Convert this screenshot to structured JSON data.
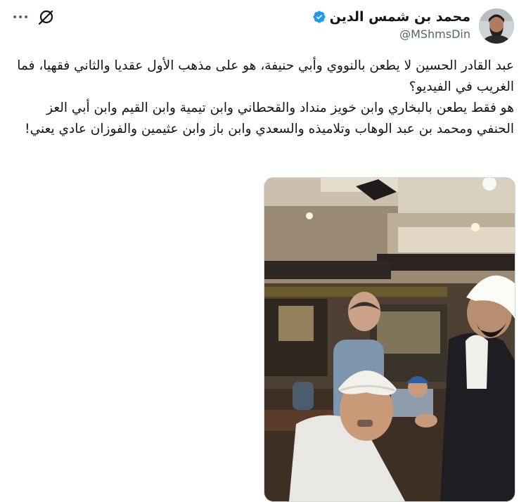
{
  "author": {
    "display_name": "محمد بن شمس الدين",
    "handle": "@MShmsDin",
    "verified": true
  },
  "icons": {
    "verified": "verified-badge-icon",
    "grok": "grok-icon",
    "more": "more-options-icon"
  },
  "tweet": {
    "paragraph_1": "عبد القادر الحسين لا يطعن بالنووي وأبي حنيفة، هو على مذهب الأول عقديا والثاني فقهيا، فما الغريب في الفيديو؟",
    "paragraph_2": "هو فقط يطعن بالبخاري وابن خويز منداد والقحطاني وابن تيمية وابن القيم وابن أبي العز الحنفي ومحمد بن عبد الوهاب وتلاميذه والسعدي وابن باز وابن عثيمين والفوزان عادي يعني!"
  },
  "media": {
    "type": "video-thumbnail"
  },
  "colors": {
    "text_primary": "#0f1419",
    "text_secondary": "#536471",
    "verified_blue": "#1d9bf0",
    "border": "#cfd9de"
  }
}
